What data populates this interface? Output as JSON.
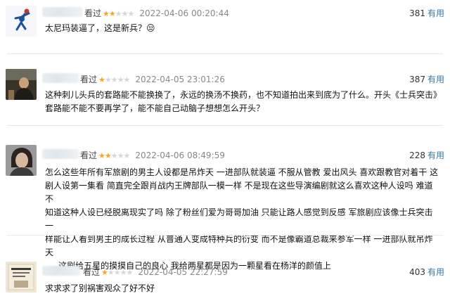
{
  "reviews": [
    {
      "seen_label": "看过",
      "stars": 2,
      "date": "2022-04-06 00:20:44",
      "useful_count": "381",
      "useful_label": "有用",
      "content": [
        "太尼玛装逼了，这是新兵？😒"
      ]
    },
    {
      "seen_label": "看过",
      "stars": 1,
      "date": "2022-04-05 23:01:26",
      "useful_count": "387",
      "useful_label": "有用",
      "content": [
        "这种刺儿头兵的套路能不能换换了，永远的换汤不换药，也不知道拍出来到底为了什么。开头《士兵突击》",
        "套路能不能不要再学了，能不能自己动脑子想想怎么开头？"
      ]
    },
    {
      "seen_label": "看过",
      "stars": 2,
      "date": "2022-04-06 08:49:59",
      "useful_count": "228",
      "useful_label": "有用",
      "content": [
        "怎么这些年所有军旅剧的男主人设都是吊炸天 一进部队就装逼 不服从管教 爱出风头 喜欢跟教官对着干 这",
        "剧人设第一集看 简直完全跟肖战内王牌部队一模一样 不是现在这些导演编剧就这么喜欢这种人设吗 难道不",
        "知道这种人设已经脱离现实了吗 除了粉丝们爱为哥哥加油 只能让路人感觉到反感 军旅剧应该像士兵突击一",
        "样能让人看到男主的成长过程 从普通人变成特种兵的衍变 而不是像霸道总裁来参军一样 一进部队就吊炸天",
        ".....这剧给五星的摸摸自己的良心 我给两星都是因为一颗星看在杨洋的颜值上"
      ]
    },
    {
      "seen_label": "看过",
      "stars": 1,
      "date": "2022-04-05 22:27:59",
      "useful_count": "403",
      "useful_label": "有用",
      "content": [
        "求求求了别祸害观众了好不好"
      ]
    }
  ],
  "colors": {
    "star_on": "#f5a623",
    "star_off": "#d6d6d6",
    "useful_link": "#3377aa"
  }
}
